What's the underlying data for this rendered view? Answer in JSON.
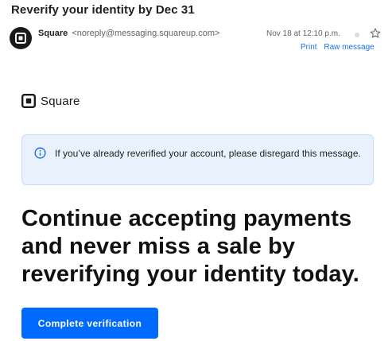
{
  "email": {
    "subject": "Reverify your identity by Dec 31",
    "sender_name": "Square",
    "sender_email": "<noreply@messaging.squareup.com>",
    "date": "Nov 18 at 12:10 p.m.",
    "actions": {
      "print": "Print",
      "raw": "Raw message"
    },
    "icons": {
      "avatar": "square-logo-icon",
      "read_status": "dot-icon",
      "star": "star-icon"
    }
  },
  "body": {
    "brand": {
      "name": "Square",
      "logo_icon": "square-logo-icon"
    },
    "notice": {
      "icon": "info-icon",
      "text": "If you’ve already reverified your account, please disregard this message."
    },
    "headline": "Continue accepting payments and never miss a sale by reverifying your identity today.",
    "cta_label": "Complete verification"
  },
  "colors": {
    "accent": "#006aff",
    "notice_background": "#e8f1fc",
    "link": "#1a73e8"
  }
}
